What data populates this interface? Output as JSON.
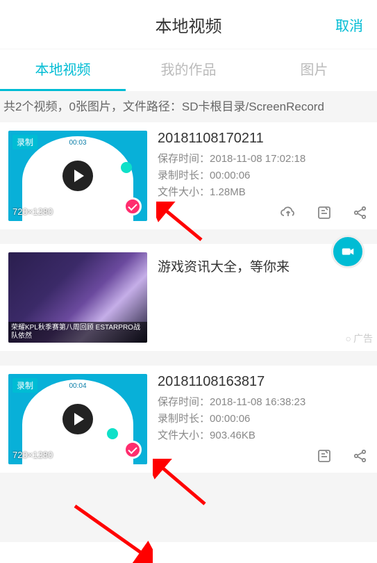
{
  "header": {
    "title": "本地视频",
    "cancel": "取消"
  },
  "tabs": [
    {
      "label": "本地视频",
      "active": true
    },
    {
      "label": "我的作品",
      "active": false
    },
    {
      "label": "图片",
      "active": false
    }
  ],
  "status": "共2个视频，0张图片，文件路径：SD卡根目录/ScreenRecord",
  "videos": [
    {
      "rec": "录制",
      "thumb_time": "00:03",
      "resolution": "720×1280",
      "title": "20181108170211",
      "save_label": "保存时间：",
      "save_value": "2018-11-08 17:02:18",
      "dur_label": "录制时长：",
      "dur_value": "00:00:06",
      "size_label": "文件大小：",
      "size_value": "1.28MB",
      "has_cloud": true
    },
    {
      "rec": "录制",
      "thumb_time": "00:04",
      "resolution": "720×1280",
      "title": "20181108163817",
      "save_label": "保存时间：",
      "save_value": "2018-11-08 16:38:23",
      "dur_label": "录制时长：",
      "dur_value": "00:00:06",
      "size_label": "文件大小：",
      "size_value": "903.46KB",
      "has_cloud": false
    }
  ],
  "ad": {
    "title": "游戏资讯大全，等你来",
    "caption": "荣耀KPL秋季赛第八周回顾 ESTARPRO战队依然",
    "label": "广告"
  }
}
